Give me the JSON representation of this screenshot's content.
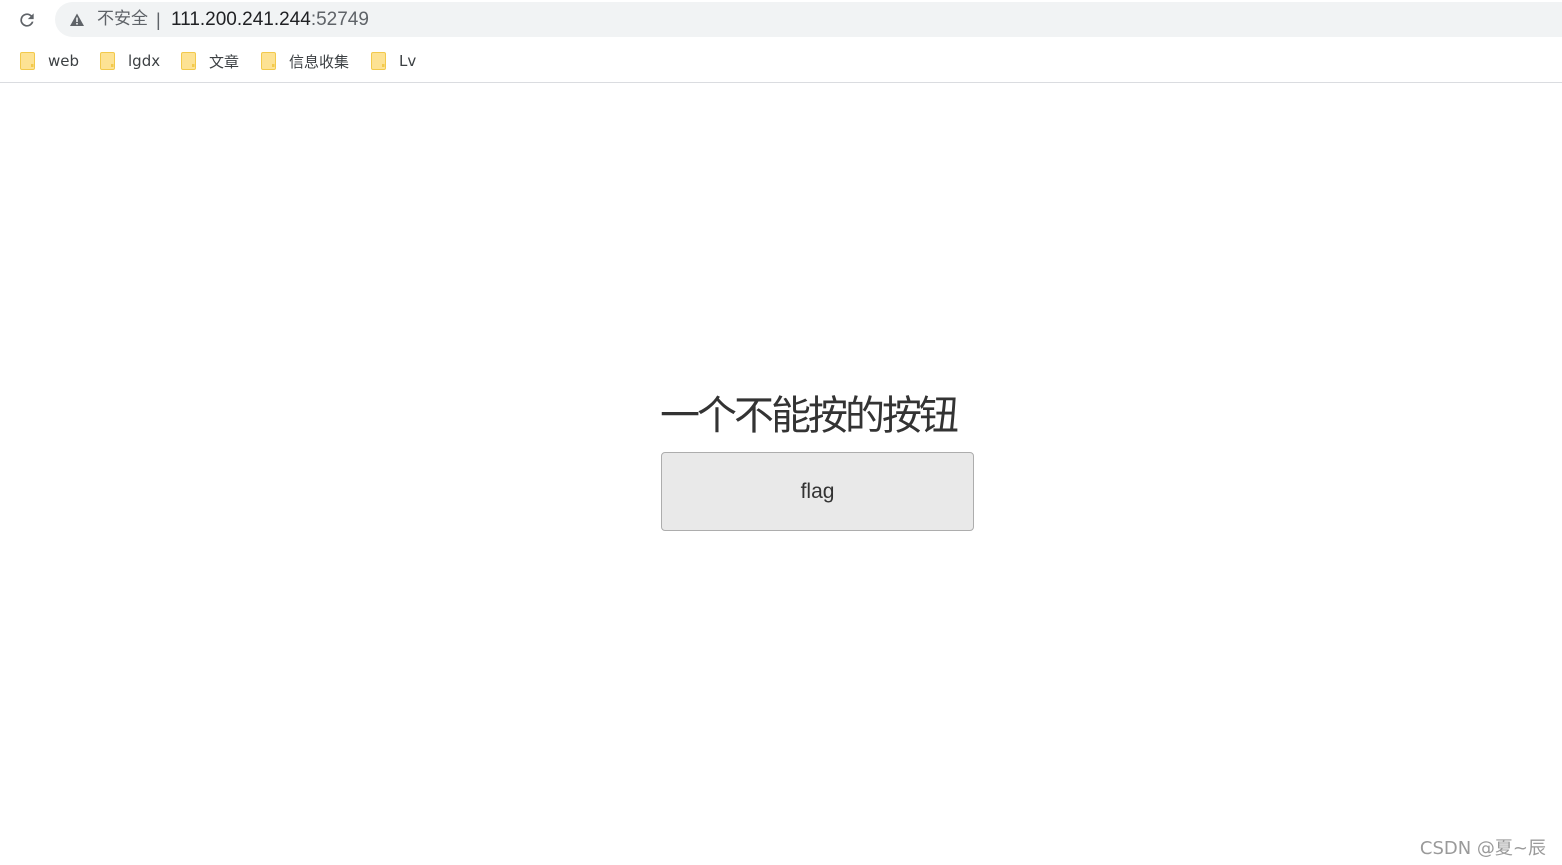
{
  "browser": {
    "security_label": "不安全",
    "separator": "|",
    "url_host": "111.200.241.244",
    "url_port": ":52749"
  },
  "bookmarks": [
    {
      "label": "web",
      "icon": "folder-icon"
    },
    {
      "label": "lgdx",
      "icon": "folder-icon"
    },
    {
      "label": "文章",
      "icon": "folder-icon"
    },
    {
      "label": "信息收集",
      "icon": "folder-icon"
    },
    {
      "label": "Lv",
      "icon": "folder-icon"
    }
  ],
  "page": {
    "heading": "一个不能按的按钮",
    "button_label": "flag"
  },
  "watermark": "CSDN @夏~辰",
  "colors": {
    "omnibox_bg": "#f1f3f4",
    "button_bg": "#e9e9e9",
    "folder_yellow": "#fde293"
  }
}
